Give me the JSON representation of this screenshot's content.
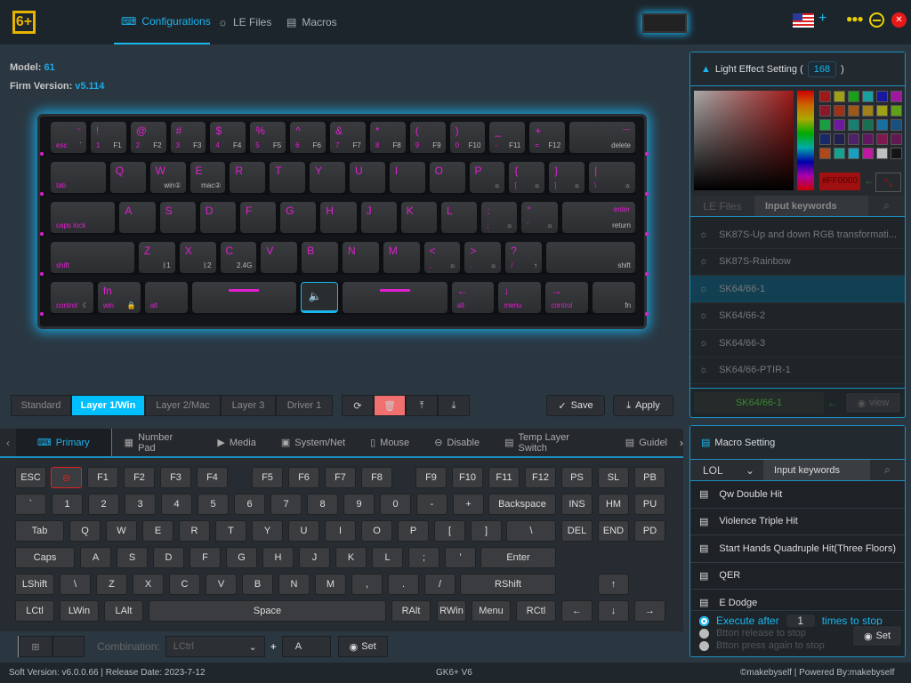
{
  "app": {
    "logo_text": "6+",
    "nav": [
      {
        "label": "Configurations",
        "icon": "keyboard-icon"
      },
      {
        "label": "LE Files",
        "icon": "bulb-icon"
      },
      {
        "label": "Macros",
        "icon": "document-icon"
      }
    ],
    "active_nav": 0
  },
  "device": {
    "model_label": "Model:",
    "model": "61",
    "firm_label": "Firm Version:",
    "firm": "v5.114"
  },
  "keyboard": {
    "rows": [
      [
        {
          "tr": "~",
          "bl": "esc",
          "br": "`"
        },
        {
          "tl": "!",
          "bl": "1",
          "br": "F1"
        },
        {
          "tl": "@",
          "bl": "2",
          "br": "F2"
        },
        {
          "tl": "#",
          "bl": "3",
          "br": "F3"
        },
        {
          "tl": "$",
          "bl": "4",
          "br": "F4"
        },
        {
          "tl": "%",
          "bl": "5",
          "br": "F5"
        },
        {
          "tl": "^",
          "bl": "6",
          "br": "F6"
        },
        {
          "tl": "&",
          "bl": "7",
          "br": "F7"
        },
        {
          "tl": "*",
          "bl": "8",
          "br": "F8"
        },
        {
          "tl": "(",
          "bl": "9",
          "br": "F9"
        },
        {
          "tl": ")",
          "bl": "0",
          "br": "F10"
        },
        {
          "tl": "_",
          "bl": "-",
          "br": "F11"
        },
        {
          "tl": "+",
          "bl": "=",
          "br": "F12"
        },
        {
          "tr": "—",
          "br": "delete"
        }
      ],
      [
        {
          "bl": "tab"
        },
        {
          "tl": "Q"
        },
        {
          "tl": "W",
          "br": "win①"
        },
        {
          "tl": "E",
          "br": "mac②"
        },
        {
          "tl": "R"
        },
        {
          "tl": "T"
        },
        {
          "tl": "Y"
        },
        {
          "tl": "U"
        },
        {
          "tl": "I"
        },
        {
          "tl": "O"
        },
        {
          "tl": "P",
          "br": "☼"
        },
        {
          "tl": "{",
          "bl": "[",
          "br": "☼"
        },
        {
          "tl": "}",
          "bl": "]",
          "br": "☼"
        },
        {
          "tl": "|",
          "bl": "\\",
          "br": "☼"
        }
      ],
      [
        {
          "bl": "caps lock"
        },
        {
          "tl": "A"
        },
        {
          "tl": "S"
        },
        {
          "tl": "D"
        },
        {
          "tl": "F"
        },
        {
          "tl": "G"
        },
        {
          "tl": "H"
        },
        {
          "tl": "J"
        },
        {
          "tl": "K"
        },
        {
          "tl": "L"
        },
        {
          "tl": ":",
          "bl": ";",
          "br": "☼"
        },
        {
          "tl": "\"",
          "bl": "'",
          "br": "☼"
        },
        {
          "tr": "enter",
          "br": "return"
        }
      ],
      [
        {
          "bl": "shift"
        },
        {
          "tl": "Z",
          "br": "ᛒ1"
        },
        {
          "tl": "X",
          "br": "ᛒ2"
        },
        {
          "tl": "C",
          "br": "2.4G"
        },
        {
          "tl": "V"
        },
        {
          "tl": "B"
        },
        {
          "tl": "N"
        },
        {
          "tl": "M"
        },
        {
          "tl": "<",
          "bl": ",",
          "br": "☼"
        },
        {
          "tl": ">",
          "bl": ".",
          "br": "☼"
        },
        {
          "tl": "?",
          "bl": "/",
          "br": "↑"
        },
        {
          "br": "shift"
        }
      ],
      [
        {
          "bl": "control",
          "br": "☾"
        },
        {
          "tl": "fn",
          "bl": "win",
          "br": "🔒"
        },
        {
          "bl": "alt"
        },
        {
          "space": true
        },
        {
          "knob": true
        },
        {
          "space": true
        },
        {
          "tl": "←",
          "bl": "alt"
        },
        {
          "tl": "↓",
          "bl": "menu"
        },
        {
          "tl": "→",
          "bl": "control"
        },
        {
          "br": "fn"
        }
      ]
    ]
  },
  "layers": {
    "items": [
      "Standard",
      "Layer 1/Win",
      "Layer 2/Mac",
      "Layer 3",
      "Driver 1"
    ],
    "active": 1,
    "tools": [
      {
        "icon": "refresh-icon",
        "glyph": "⟳"
      },
      {
        "icon": "trash-icon",
        "glyph": "🗑"
      },
      {
        "icon": "upload-icon",
        "glyph": "⤒"
      },
      {
        "icon": "download-icon",
        "glyph": "⤓"
      }
    ],
    "save": "Save",
    "apply": "Apply"
  },
  "categories": {
    "items": [
      {
        "label": "Primary",
        "icon": "keyboard-icon",
        "glyph": "⌨"
      },
      {
        "label": "Number Pad",
        "icon": "calculator-icon",
        "glyph": "▦"
      },
      {
        "label": "Media",
        "icon": "play-icon",
        "glyph": "▶"
      },
      {
        "label": "System/Net",
        "icon": "monitor-icon",
        "glyph": "▣"
      },
      {
        "label": "Mouse",
        "icon": "mouse-icon",
        "glyph": "▯"
      },
      {
        "label": "Disable",
        "icon": "disable-icon",
        "glyph": "⊖"
      },
      {
        "label": "Temp Layer Switch",
        "icon": "file-icon",
        "glyph": "▤"
      },
      {
        "label": "Guidel",
        "icon": "guide-icon",
        "glyph": "▤"
      }
    ],
    "active": 0
  },
  "keygrid": {
    "rows": [
      [
        "ESC",
        "⊖",
        "F1",
        "F2",
        "F3",
        "F4",
        "F5",
        "F6",
        "F7",
        "F8",
        "F9",
        "F10",
        "F11",
        "F12",
        "PS",
        "SL",
        "PB"
      ],
      [
        "`",
        "1",
        "2",
        "3",
        "4",
        "5",
        "6",
        "7",
        "8",
        "9",
        "0",
        "-",
        "+",
        "Backspace",
        "INS",
        "HM",
        "PU"
      ],
      [
        "Tab",
        "Q",
        "W",
        "E",
        "R",
        "T",
        "Y",
        "U",
        "I",
        "O",
        "P",
        "[",
        "]",
        "\\",
        "DEL",
        "END",
        "PD"
      ],
      [
        "Caps",
        "A",
        "S",
        "D",
        "F",
        "G",
        "H",
        "J",
        "K",
        "L",
        ";",
        "'",
        "Enter"
      ],
      [
        "LShift",
        "\\",
        "Z",
        "X",
        "C",
        "V",
        "B",
        "N",
        "M",
        ",",
        ".",
        "/",
        "RShift",
        "↑"
      ],
      [
        "LCtl",
        "LWin",
        "LAlt",
        "Space",
        "RAlt",
        "RWin",
        "Menu",
        "RCtl",
        "←",
        "↓",
        "→"
      ]
    ],
    "selected": "⊖"
  },
  "combination": {
    "label": "Combination:",
    "modifier": "LCtrl",
    "plus": "+",
    "key": "A",
    "set": "Set"
  },
  "light_effect": {
    "title": "Light Effect Setting (",
    "count": "168",
    "close": ")",
    "hex": "#FF0000",
    "swatches": [
      "#a01818",
      "#a0a018",
      "#18a018",
      "#18a0a0",
      "#1818a0",
      "#a018a0",
      "#8a1828",
      "#a03018",
      "#a05818",
      "#a08018",
      "#a0a018",
      "#60a018",
      "#18a040",
      "#7018a0",
      "#188070",
      "#187050",
      "#1870a0",
      "#185080",
      "#182868",
      "#202050",
      "#502068",
      "#601860",
      "#801850",
      "#601850",
      "#b04818",
      "#18a090",
      "#18a0c0",
      "#c018a0",
      "#c0c0c0",
      "#151515"
    ],
    "tabs": [
      "LE Files",
      "Input keywords"
    ],
    "files": [
      "SK87S-Up and down RGB transformati...",
      "SK87S-Rainbow",
      "SK64/66-1",
      "SK64/66-2",
      "SK64/66-3",
      "SK64/66-PTIR-1"
    ],
    "selected": 2,
    "current": "SK64/66-1",
    "view": "view",
    "colors": {
      "accent": "#1ab7f0",
      "selected_key": "#e020d0"
    }
  },
  "macro": {
    "title": "Macro Setting",
    "group": "LOL",
    "search_placeholder": "Input keywords",
    "items": [
      "Qw Double Hit",
      "Violence Triple Hit",
      "Start Hands Quadruple Hit(Three Floors)",
      "QER",
      "E Dodge"
    ],
    "options": [
      {
        "pre": "Execute after",
        "value": "1",
        "post": "times to stop"
      },
      {
        "label": "Btton release to stop"
      },
      {
        "label": "Btton press again to stop"
      }
    ],
    "selected_option": 0,
    "set": "Set"
  },
  "status": {
    "version": "Soft Version: v6.0.0.66 | Release Date: 2023-7-12",
    "device": "GK6+ V6",
    "credit": "©makebyself | Powered By:makebyself"
  }
}
